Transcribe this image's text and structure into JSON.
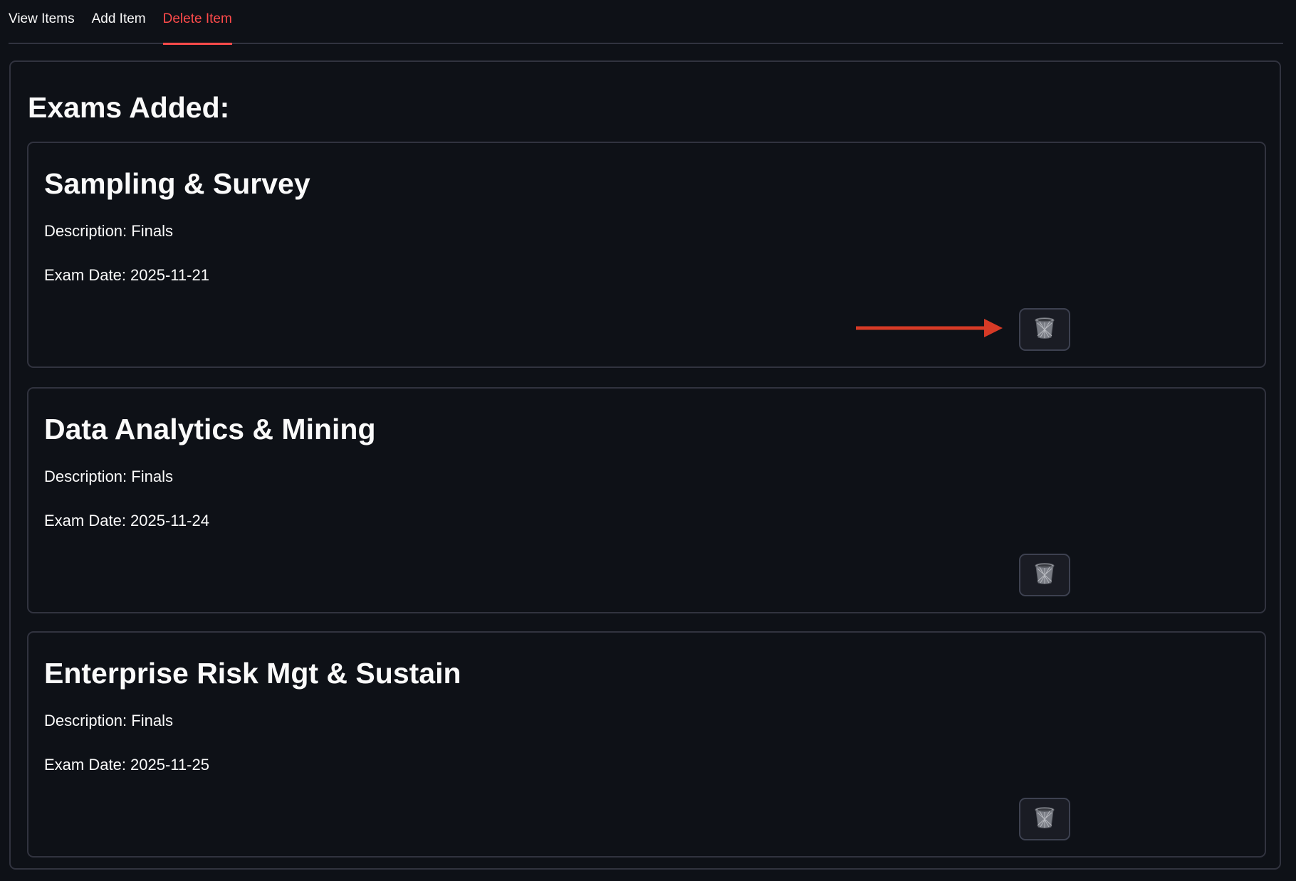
{
  "tabs": [
    {
      "label": "View Items",
      "active": false
    },
    {
      "label": "Add Item",
      "active": false
    },
    {
      "label": "Delete Item",
      "active": true
    }
  ],
  "heading": "Exams Added:",
  "exams": [
    {
      "title": "Sampling & Survey",
      "description": "Description: Finals",
      "date": "Exam Date: 2025-11-21"
    },
    {
      "title": "Data Analytics & Mining",
      "description": "Description: Finals",
      "date": "Exam Date: 2025-11-24"
    },
    {
      "title": "Enterprise Risk Mgt & Sustain",
      "description": "Description: Finals",
      "date": "Exam Date: 2025-11-25"
    }
  ],
  "icons": {
    "delete": "trash-can-icon",
    "annotation": "red-arrow"
  },
  "colors": {
    "background": "#0e1117",
    "accent": "#ff4b4b",
    "border": "#31333f",
    "text": "#fafafa",
    "arrow": "#d63a26"
  }
}
